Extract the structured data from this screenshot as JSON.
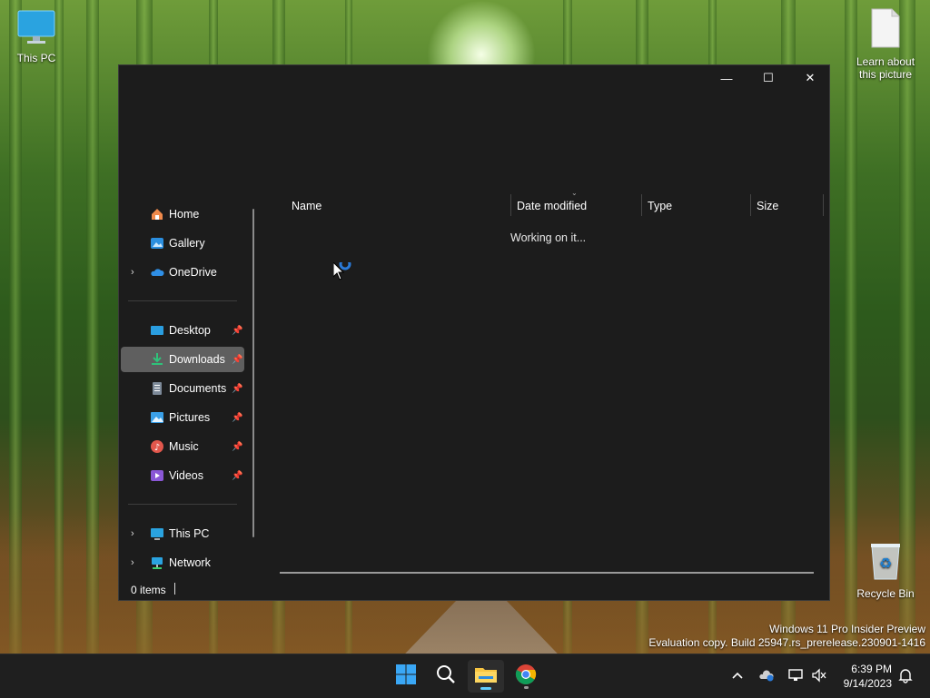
{
  "desktop": {
    "icons": [
      {
        "label": "This PC"
      },
      {
        "label": "Learn about this picture"
      },
      {
        "label": "Recycle Bin"
      }
    ]
  },
  "window": {
    "controls": {
      "minimize": "—",
      "maximize": "☐",
      "close": "✕"
    },
    "nav": {
      "items": [
        {
          "label": "Home"
        },
        {
          "label": "Gallery"
        },
        {
          "label": "OneDrive"
        },
        {
          "label": "Desktop"
        },
        {
          "label": "Downloads"
        },
        {
          "label": "Documents"
        },
        {
          "label": "Pictures"
        },
        {
          "label": "Music"
        },
        {
          "label": "Videos"
        },
        {
          "label": "This PC"
        },
        {
          "label": "Network"
        }
      ]
    },
    "columns": [
      "Name",
      "Date modified",
      "Type",
      "Size"
    ],
    "status_message": "Working on it...",
    "status_bar": {
      "item_count": "0 items"
    }
  },
  "watermark": {
    "line1": "Windows 11 Pro Insider Preview",
    "line2": "Evaluation copy. Build 25947.rs_prerelease.230901-1416"
  },
  "taskbar": {
    "clock": {
      "time": "6:39 PM",
      "date": "9/14/2023"
    }
  },
  "colors": {
    "window_bg": "#1c1c1c",
    "selected_nav": "#5f5f5f",
    "accent": "#60cdff",
    "taskbar_bg": "#1f1f1f"
  }
}
